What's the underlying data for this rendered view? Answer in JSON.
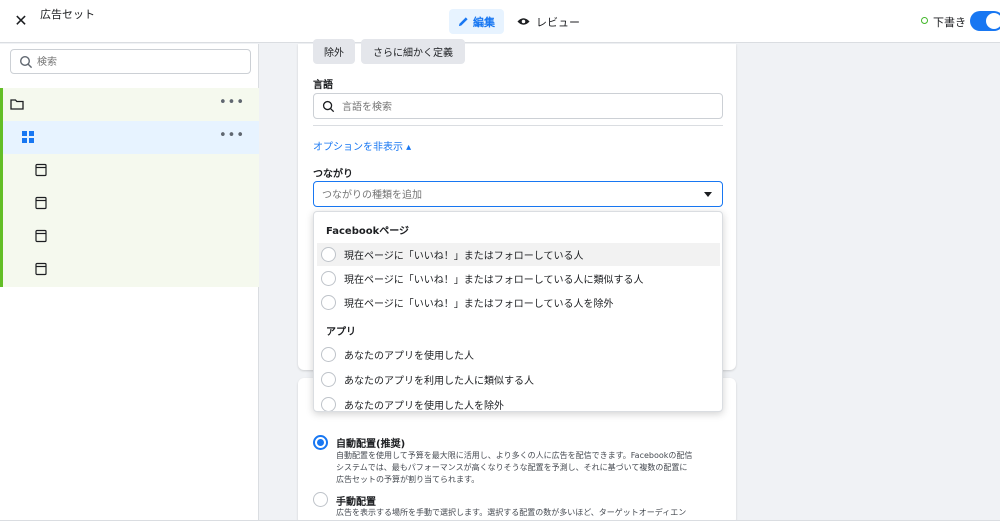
{
  "header": {
    "title": "広告セット",
    "tab_edit": "編集",
    "tab_review": "レビュー",
    "status": "下書き",
    "colors": {
      "accent": "#1877f2",
      "status": "#42b72a"
    }
  },
  "sidebar": {
    "search_placeholder": "検索",
    "items": [
      {
        "icon": "folder-icon",
        "selected": false,
        "has_menu": true
      },
      {
        "icon": "grid-icon",
        "selected": true,
        "has_menu": true
      },
      {
        "icon": "ad-page-icon",
        "selected": false,
        "has_menu": false
      },
      {
        "icon": "ad-page-icon",
        "selected": false,
        "has_menu": false
      },
      {
        "icon": "ad-page-icon",
        "selected": false,
        "has_menu": false
      },
      {
        "icon": "ad-page-icon",
        "selected": false,
        "has_menu": false
      }
    ],
    "more_label": "•••",
    "tree_accent": "#63be26"
  },
  "targeting": {
    "exclude_label": "除外",
    "narrow_label": "さらに細かく定義",
    "language_label": "言語",
    "language_placeholder": "言語を検索",
    "options_toggle": "オプションを非表示 ▴",
    "connections_label": "つながり",
    "connections_placeholder": "つながりの種類を追加"
  },
  "dropdown": {
    "group1_title": "Facebookページ",
    "group1_items": [
      "現在ページに「いいね！」またはフォローしている人",
      "現在ページに「いいね！」またはフォローしている人に類似する人",
      "現在ページに「いいね！」またはフォローしている人を除外"
    ],
    "group2_title": "アプリ",
    "group2_items": [
      "あなたのアプリを使用した人",
      "あなたのアプリを利用した人に類似する人",
      "あなたのアプリを使用した人を除外"
    ]
  },
  "placements": {
    "auto_title": "自動配置(推奨)",
    "auto_desc_1": "自動配置を使用して予算を最大限に活用し、より多くの人に広告を配信できます。Facebookの配信",
    "auto_desc_2": "システムでは、最もパフォーマンスが高くなりそうな配置を予測し、それに基づいて複数の配置に",
    "auto_desc_3": "広告セットの予算が割り当てられます。",
    "manual_title": "手動配置",
    "manual_desc_1": "広告を表示する場所を手動で選択します。選択する配置の数が多いほど、ターゲットオーディエン",
    "selected": "auto"
  }
}
